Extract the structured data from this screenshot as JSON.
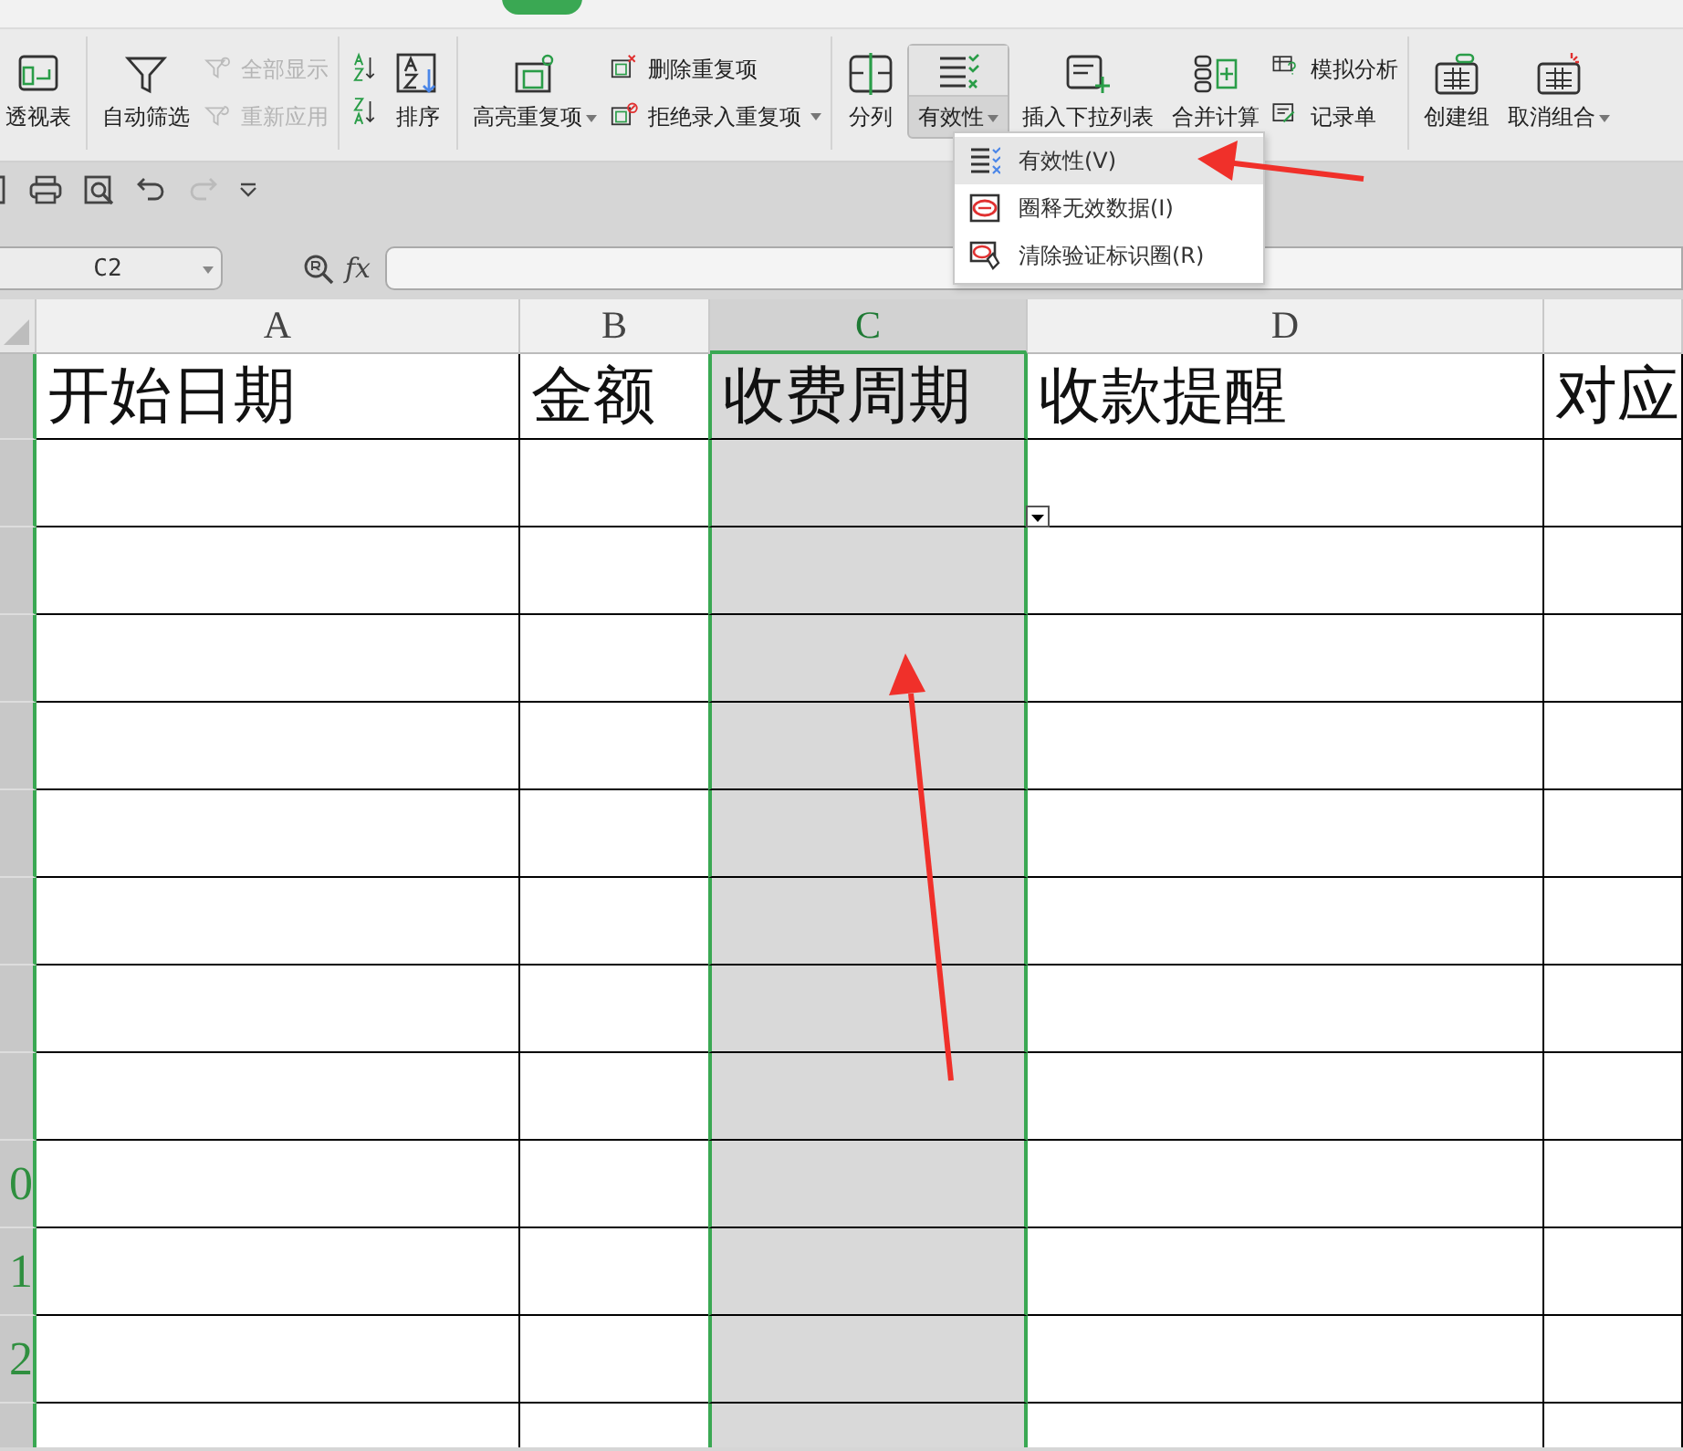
{
  "ribbon_groups": [
    [
      {
        "kind": "large",
        "label": "透视表",
        "dropdown": false,
        "pressed": false
      }
    ],
    [
      {
        "kind": "large",
        "label": "自动筛选",
        "dropdown": false,
        "pressed": false
      },
      {
        "kind": "stack",
        "items": [
          {
            "label": "全部显示",
            "disabled": true,
            "dropdown": false
          },
          {
            "label": "重新应用",
            "disabled": true,
            "dropdown": false
          }
        ]
      }
    ],
    [
      {
        "kind": "icons"
      },
      {
        "kind": "large",
        "label": "排序",
        "dropdown": false,
        "pressed": false
      }
    ],
    [
      {
        "kind": "large",
        "label": "高亮重复项",
        "dropdown": true,
        "pressed": false
      },
      {
        "kind": "stack",
        "items": [
          {
            "label": "删除重复项",
            "disabled": false,
            "dropdown": false
          },
          {
            "label": "拒绝录入重复项",
            "disabled": false,
            "dropdown": true
          }
        ]
      }
    ],
    [
      {
        "kind": "large",
        "label": "分列",
        "dropdown": false,
        "pressed": false
      },
      {
        "kind": "large",
        "label": "有效性",
        "dropdown": true,
        "pressed": true
      },
      {
        "kind": "large",
        "label": "插入下拉列表",
        "dropdown": false,
        "pressed": false
      },
      {
        "kind": "large",
        "label": "合并计算",
        "dropdown": false,
        "pressed": false
      },
      {
        "kind": "stack",
        "items": [
          {
            "label": "模拟分析",
            "disabled": false,
            "dropdown": false
          },
          {
            "label": "记录单",
            "disabled": false,
            "dropdown": false
          }
        ]
      }
    ],
    [
      {
        "kind": "large",
        "label": "创建组",
        "dropdown": false,
        "pressed": false
      },
      {
        "kind": "large",
        "label": "取消组合",
        "dropdown": true,
        "pressed": false
      }
    ]
  ],
  "validity_menu": {
    "items": [
      {
        "label": "有效性(V)",
        "selected": true
      },
      {
        "label": "圈释无效数据(I)",
        "selected": false
      },
      {
        "label": "清除验证标识圈(R)",
        "selected": false
      }
    ]
  },
  "formula_bar": {
    "cell": "C2",
    "fx_label": "fx"
  },
  "sheet": {
    "columns": [
      {
        "label": "A",
        "selected": false
      },
      {
        "label": "B",
        "selected": false
      },
      {
        "label": "C",
        "selected": true
      },
      {
        "label": "D",
        "selected": false
      },
      {
        "selected": false
      }
    ],
    "header_cells": [
      "开始日期",
      "金额",
      "收费周期",
      "收款提醒",
      "对应"
    ],
    "active_cell_dropdown": true,
    "rows": [
      {},
      {},
      {},
      {},
      {},
      {},
      {},
      {},
      {
        "label": "0"
      },
      {
        "label": "1"
      },
      {
        "label": "2"
      },
      {}
    ]
  }
}
